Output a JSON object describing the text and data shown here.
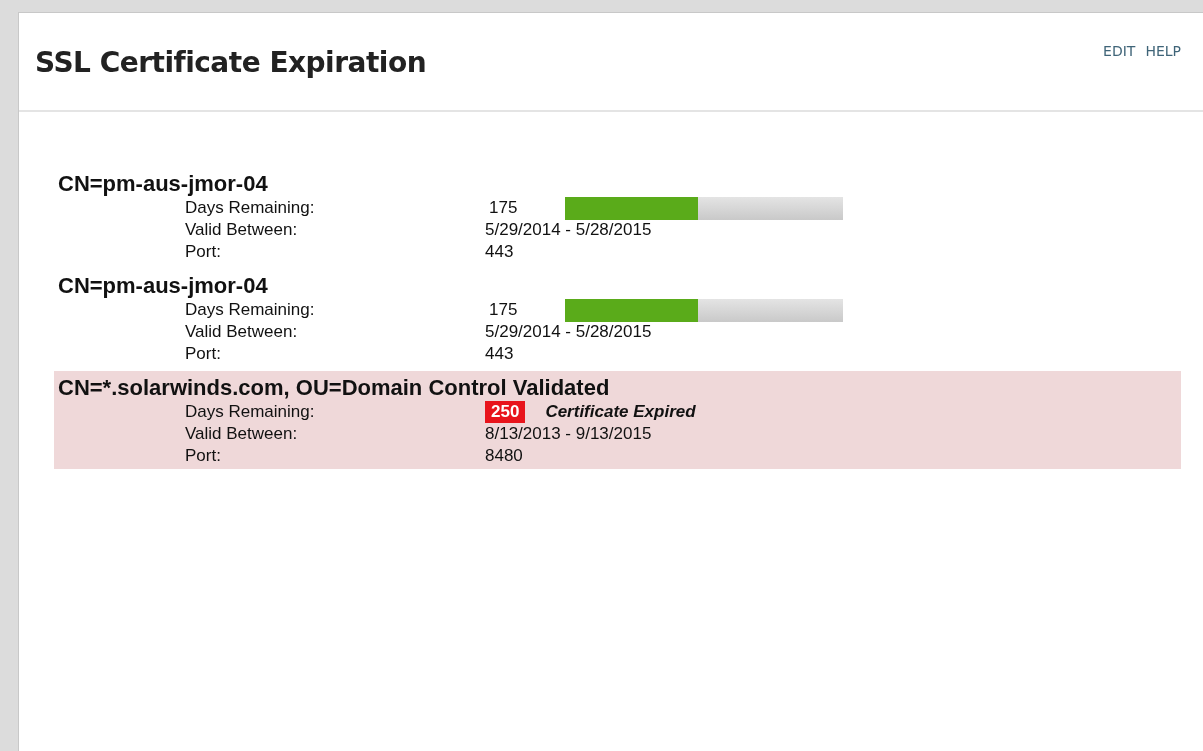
{
  "panel": {
    "title": "SSL Certificate Expiration",
    "actions": [
      "EDIT",
      "HELP"
    ]
  },
  "certificates": [
    {
      "name": "CN=pm-aus-jmor-04",
      "expired": false,
      "days_label": "Days Remaining:",
      "days": "175",
      "level": 0.48,
      "valid_label": "Valid Between:",
      "valid": "5/29/2014 - 5/28/2015",
      "port_label": "Port:",
      "port": "443"
    },
    {
      "name": "CN=pm-aus-jmor-04",
      "expired": false,
      "days_label": "Days Remaining:",
      "days": "175",
      "level": 0.48,
      "valid_label": "Valid Between:",
      "valid": "5/29/2014 - 5/28/2015",
      "port_label": "Port:",
      "port": "443"
    },
    {
      "name": "CN=*.solarwinds.com, OU=Domain Control Validated",
      "expired": true,
      "days_label": "Days Remaining:",
      "days": "250",
      "status": "Certificate Expired",
      "valid_label": "Valid Between:",
      "valid": "8/13/2013 - 9/13/2015",
      "port_label": "Port:",
      "port": "8480"
    }
  ]
}
